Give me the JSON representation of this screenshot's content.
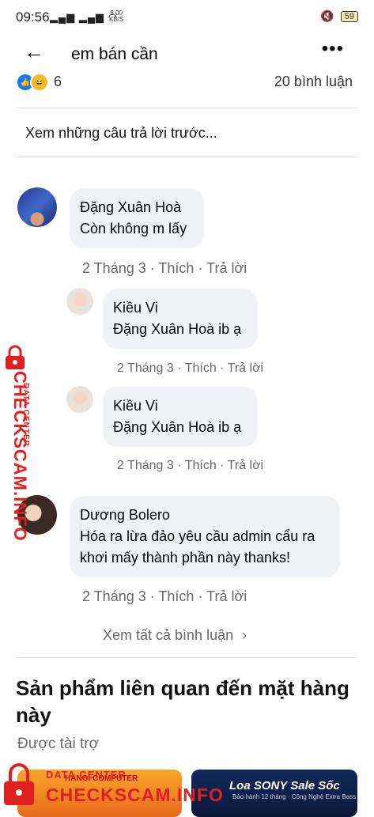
{
  "status_bar": {
    "time": "09:56",
    "speed_top": "8.00",
    "speed_unit": "KB/S",
    "battery": "59"
  },
  "header": {
    "title": "em bán cần"
  },
  "reactions": {
    "count": "6",
    "comments": "20 bình luận"
  },
  "previous_label": "Xem những câu trả lời trước...",
  "comments": [
    {
      "name": "Đặng Xuân Hoà",
      "text": "Còn không m lấy",
      "date": "2 Tháng 3",
      "like": "Thích",
      "reply": "Trả lời"
    },
    {
      "name": "Kiều Vi",
      "text": "Đặng Xuân Hoà ib ạ",
      "date": "2 Tháng 3",
      "like": "Thích",
      "reply": "Trả lời"
    },
    {
      "name": "Kiều Vi",
      "text": "Đặng Xuân Hoà ib ạ",
      "date": "2 Tháng 3",
      "like": "Thích",
      "reply": "Trả lời"
    },
    {
      "name": "Dương Bolero",
      "text": "Hóa ra lừa đảo yêu cầu admin cẩu ra khơi mấy thành phần này thanks!",
      "date": "2 Tháng 3",
      "like": "Thích",
      "reply": "Trả lời"
    }
  ],
  "see_all": "Xem tất cả bình luận",
  "related": {
    "title": "Sản phẩm liên quan đến mặt hàng này",
    "sponsored": "Được tài trợ"
  },
  "cards": [
    {
      "title": "HANOI COMPUTER"
    },
    {
      "title": "Loa SONY Sale Sốc",
      "subtitle": "Bảo hành 12 tháng · Công Nghệ Extra Bass"
    }
  ],
  "watermark": {
    "small": "DATA CENTER",
    "big": "CHECKSCAM.INFO"
  },
  "separator": " · ",
  "icons": {
    "back": "arrow-left-icon",
    "more": "more-icon",
    "like": "like-icon",
    "haha": "haha-icon",
    "chevron": "chevron-right-icon"
  }
}
